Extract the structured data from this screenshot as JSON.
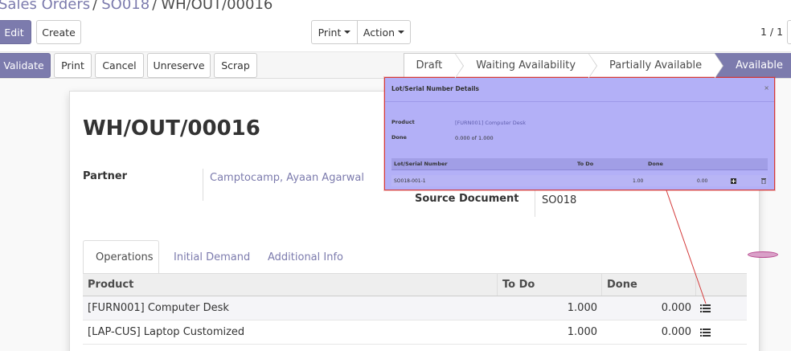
{
  "breadcrumb": {
    "root": "Sales Orders",
    "parent": "SO018",
    "current": "WH/OUT/00016",
    "separator": "/"
  },
  "control": {
    "edit": "Edit",
    "create": "Create",
    "print": "Print",
    "action": "Action",
    "pager": "1 / 1"
  },
  "header_buttons": {
    "validate": "Validate",
    "print": "Print",
    "cancel": "Cancel",
    "unreserve": "Unreserve",
    "scrap": "Scrap"
  },
  "statusbar": {
    "stages": [
      "Draft",
      "Waiting Availability",
      "Partially Available",
      "Available"
    ],
    "active": "Available"
  },
  "form": {
    "title": "WH/OUT/00016",
    "partner_label": "Partner",
    "partner_value": "Camptocamp, Ayaan Agarwal",
    "source_label": "Source Document",
    "source_value": "SO018"
  },
  "tabs": {
    "operations": "Operations",
    "initial_demand": "Initial Demand",
    "additional_info": "Additional Info"
  },
  "table": {
    "headers": {
      "product": "Product",
      "todo": "To Do",
      "done": "Done"
    },
    "rows": [
      {
        "product": "[FURN001] Computer Desk",
        "todo": "1.000",
        "done": "0.000",
        "icon": "list-icon"
      },
      {
        "product": "[LAP-CUS] Laptop Customized",
        "todo": "1.000",
        "done": "0.000",
        "icon": "list-icon"
      }
    ]
  },
  "popup": {
    "title": "Lot/Serial Number Details",
    "close": "×",
    "product_label": "Product",
    "product_value": "[FURN001] Computer Desk",
    "done_label": "Done",
    "done_value": "0.000 of 1.000",
    "headers": {
      "lot": "Lot/Serial Number",
      "todo": "To Do",
      "done": "Done"
    },
    "row": {
      "lot": "SO018-001-1",
      "todo": "1.00",
      "done": "0.00"
    }
  },
  "colors": {
    "brand": "#7c7bad",
    "popup_bg": "#b3b0f7",
    "annotation": "#d43a3a"
  }
}
